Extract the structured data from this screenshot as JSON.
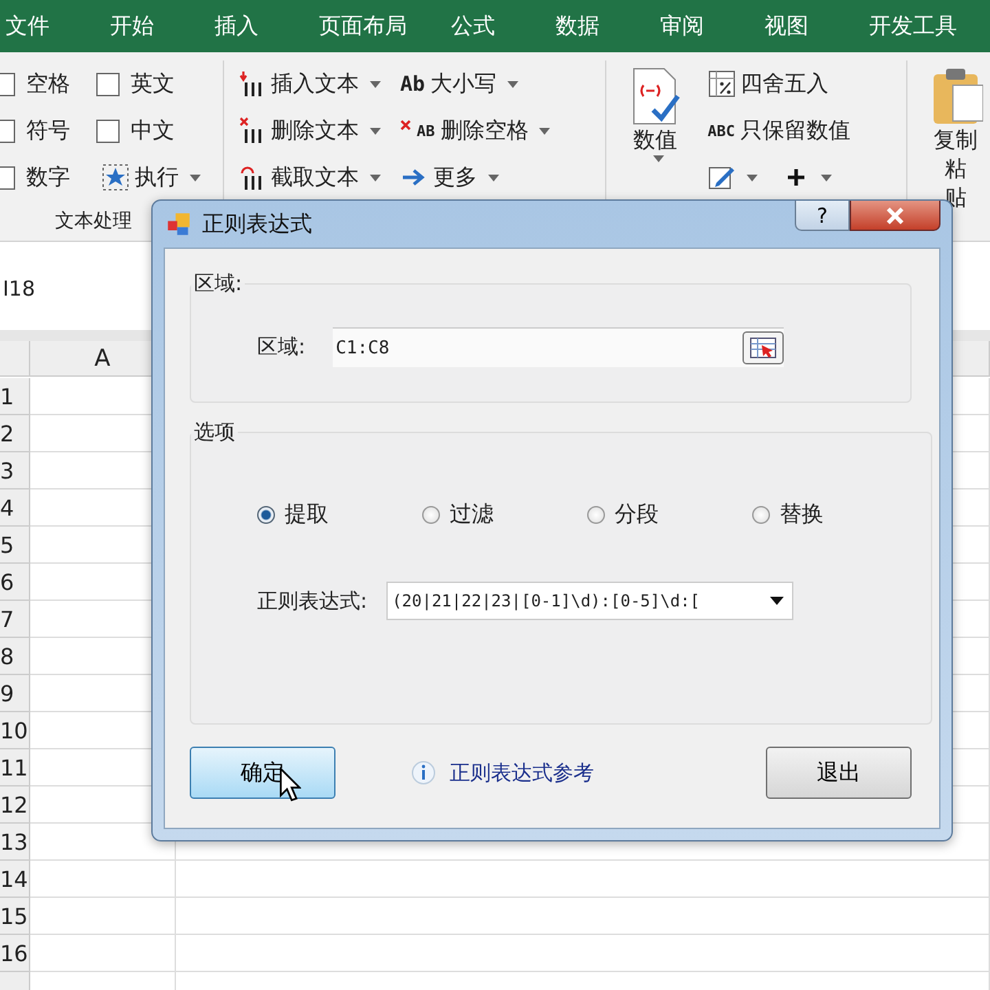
{
  "tabs": [
    "文件",
    "开始",
    "插入",
    "页面布局",
    "公式",
    "数据",
    "审阅",
    "视图",
    "开发工具"
  ],
  "ribbon": {
    "checkboxes": [
      {
        "label": "空格",
        "checked": false
      },
      {
        "label": "英文",
        "checked": false
      },
      {
        "label": "符号",
        "checked": false
      },
      {
        "label": "中文",
        "checked": false
      },
      {
        "label": "数字",
        "checked": false
      }
    ],
    "run_button": "执行",
    "group_label": "文本处理",
    "text_tools": [
      {
        "label": "插入文本",
        "kind": "insert"
      },
      {
        "label": "删除文本",
        "kind": "delete"
      },
      {
        "label": "截取文本",
        "kind": "cut"
      }
    ],
    "more_tools": [
      {
        "label": "大小写",
        "kind": "case",
        "glyph": "Ab"
      },
      {
        "label": "删除空格",
        "kind": "trim",
        "glyph": "AB"
      },
      {
        "label": "更多",
        "kind": "more"
      }
    ],
    "number_button": "数值",
    "number_tools": [
      {
        "label": "四舍五入",
        "kind": "round"
      },
      {
        "label": "只保留数值",
        "kind": "keep",
        "glyph": "ABC"
      }
    ],
    "paste_button": [
      "复制粘",
      "贴"
    ]
  },
  "name_box": "I18",
  "sheet": {
    "column": "A",
    "rows": [
      "1",
      "2",
      "3",
      "4",
      "5",
      "6",
      "7",
      "8",
      "9",
      "10",
      "11",
      "12",
      "13",
      "14",
      "15",
      "16"
    ]
  },
  "dialog": {
    "title": "正则表达式",
    "help_button": "?",
    "range_group": {
      "legend": "区域:",
      "label": "区域:",
      "value": "C1:C8"
    },
    "options_group": {
      "legend": "选项",
      "options": [
        {
          "label": "提取",
          "selected": true
        },
        {
          "label": "过滤",
          "selected": false
        },
        {
          "label": "分段",
          "selected": false
        },
        {
          "label": "替换",
          "selected": false
        }
      ],
      "regex_label": "正则表达式:",
      "regex_value": "(20|21|22|23|[0-1]\\d):[0-5]\\d:["
    },
    "ok_button": {
      "label": "确定",
      "hovered": true
    },
    "help_link": "正则表达式参考",
    "exit_button": "退出"
  }
}
